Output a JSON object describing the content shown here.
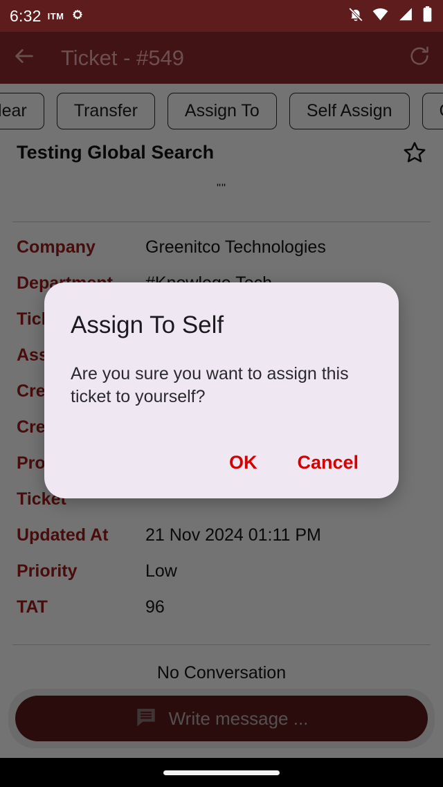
{
  "status_bar": {
    "time": "6:32",
    "carrier": "ITM",
    "icons": [
      "gear-icon",
      "notifications-off-icon",
      "wifi-icon",
      "cellular-signal-icon",
      "battery-full-icon"
    ]
  },
  "app_bar": {
    "title": "Ticket - #549",
    "back_icon": "back-arrow-icon",
    "refresh_icon": "refresh-icon"
  },
  "actions": [
    {
      "label": "Clear"
    },
    {
      "label": "Transfer"
    },
    {
      "label": "Assign To"
    },
    {
      "label": "Self Assign"
    },
    {
      "label": "Change C"
    }
  ],
  "ticket": {
    "title": "Testing Global Search",
    "description": "\"\"",
    "favorite_icon": "star-outline-icon",
    "fields": [
      {
        "label": "Company",
        "value": "Greenitco Technologies"
      },
      {
        "label": "Department",
        "value": "#Knowlege Tech"
      },
      {
        "label": "Ticket",
        "value": ""
      },
      {
        "label": "Assigned",
        "value": ""
      },
      {
        "label": "Created",
        "value": ""
      },
      {
        "label": "Created By",
        "value": ""
      },
      {
        "label": "Product",
        "value": ""
      },
      {
        "label": "Ticket",
        "value": ""
      },
      {
        "label": "Updated At",
        "value": "21 Nov 2024 01:11 PM"
      },
      {
        "label": "Priority",
        "value": "Low"
      },
      {
        "label": "TAT",
        "value": "96"
      }
    ]
  },
  "conversation": {
    "empty_text": "No Conversation",
    "composer_placeholder": "Write message ...",
    "composer_icon": "message-icon"
  },
  "dialog": {
    "title": "Assign To Self",
    "message": "Are you sure you want to assign this ticket to yourself?",
    "confirm_label": "OK",
    "cancel_label": "Cancel"
  },
  "colors": {
    "brand": "#5E1C1D",
    "label_red": "#9E1C1C",
    "dialog_bg": "#EFE8F2",
    "dialog_action": "#D50000"
  }
}
